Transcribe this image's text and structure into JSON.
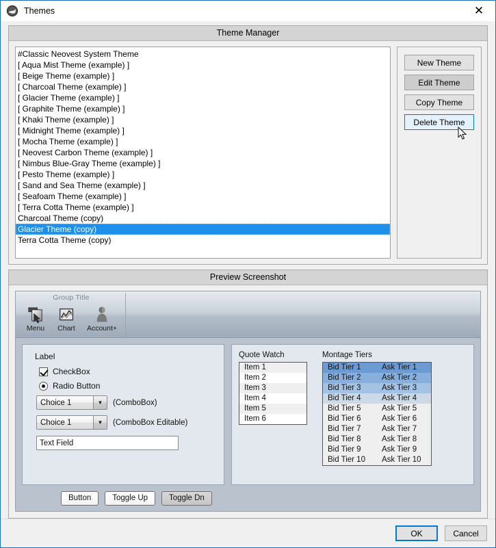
{
  "window": {
    "title": "Themes",
    "app_icon": "themes-logo-icon",
    "close_label": "✕",
    "accent_color": "#0078d7",
    "selection_color": "#1f8fec"
  },
  "theme_manager": {
    "header": "Theme Manager",
    "themes": [
      {
        "label": "#Classic Neovest System Theme",
        "selected": false
      },
      {
        "label": "[ Aqua Mist Theme (example) ]",
        "selected": false
      },
      {
        "label": "[ Beige Theme (example) ]",
        "selected": false
      },
      {
        "label": "[ Charcoal Theme (example) ]",
        "selected": false
      },
      {
        "label": "[ Glacier Theme (example) ]",
        "selected": false
      },
      {
        "label": "[ Graphite Theme (example) ]",
        "selected": false
      },
      {
        "label": "[ Khaki Theme (example) ]",
        "selected": false
      },
      {
        "label": "[ Midnight Theme (example) ]",
        "selected": false
      },
      {
        "label": "[ Mocha Theme (example) ]",
        "selected": false
      },
      {
        "label": "[ Neovest Carbon Theme (example) ]",
        "selected": false
      },
      {
        "label": "[ Nimbus Blue-Gray Theme (example) ]",
        "selected": false
      },
      {
        "label": "[ Pesto Theme (example) ]",
        "selected": false
      },
      {
        "label": "[ Sand and Sea Theme (example) ]",
        "selected": false
      },
      {
        "label": "[ Seafoam Theme (example) ]",
        "selected": false
      },
      {
        "label": "[ Terra Cotta Theme (example) ]",
        "selected": false
      },
      {
        "label": "Charcoal Theme (copy)",
        "selected": false
      },
      {
        "label": "Glacier Theme (copy)",
        "selected": true
      },
      {
        "label": "Terra Cotta Theme (copy)",
        "selected": false
      }
    ],
    "buttons": [
      {
        "label": "New Theme",
        "state": "normal"
      },
      {
        "label": "Edit Theme",
        "state": "alt"
      },
      {
        "label": "Copy Theme",
        "state": "normal"
      },
      {
        "label": "Delete Theme",
        "state": "hovered"
      }
    ]
  },
  "preview": {
    "header": "Preview Screenshot",
    "ribbon": {
      "group_title": "Group Title",
      "items": [
        {
          "label": "Menu",
          "icon": "menu-page-cursor-icon"
        },
        {
          "label": "Chart",
          "icon": "line-chart-icon"
        },
        {
          "label": "Account+",
          "icon": "account-person-icon"
        }
      ]
    },
    "form": {
      "label": "Label",
      "checkbox": {
        "label": "CheckBox",
        "checked": true
      },
      "radio": {
        "label": "Radio Button",
        "checked": true
      },
      "combo1": {
        "value": "Choice 1",
        "note": "(ComboBox)"
      },
      "combo2": {
        "value": "Choice 1",
        "note": "(ComboBox Editable)"
      },
      "textfield": {
        "value": "Text Field",
        "placeholder": "Text Field"
      }
    },
    "quote_watch": {
      "title": "Quote Watch",
      "items": [
        "Item 1",
        "Item 2",
        "Item 3",
        "Item 4",
        "Item 5",
        "Item 6"
      ]
    },
    "montage": {
      "title": "Montage Tiers",
      "rows": [
        {
          "bid": "Bid Tier 1",
          "ask": "Ask Tier 1",
          "bg": "#6b9bd2"
        },
        {
          "bid": "Bid Tier 2",
          "ask": "Ask Tier 2",
          "bg": "#87b0de"
        },
        {
          "bid": "Bid Tier 3",
          "ask": "Ask Tier 3",
          "bg": "#a4c2e4"
        },
        {
          "bid": "Bid Tier 4",
          "ask": "Ask Tier 4",
          "bg": "#ccd9e6"
        },
        {
          "bid": "Bid Tier 5",
          "ask": "Ask Tier 5",
          "bg": "#efefef"
        },
        {
          "bid": "Bid Tier 6",
          "ask": "Ask Tier 6",
          "bg": "#efefef"
        },
        {
          "bid": "Bid Tier 7",
          "ask": "Ask Tier 7",
          "bg": "#efefef"
        },
        {
          "bid": "Bid Tier 8",
          "ask": "Ask Tier 8",
          "bg": "#efefef"
        },
        {
          "bid": "Bid Tier 9",
          "ask": "Ask Tier 9",
          "bg": "#efefef"
        },
        {
          "bid": "Bid Tier 10",
          "ask": "Ask Tier 10",
          "bg": "#efefef"
        }
      ]
    },
    "buttons": [
      {
        "label": "Button",
        "state": "normal"
      },
      {
        "label": "Toggle Up",
        "state": "normal"
      },
      {
        "label": "Toggle Dn",
        "state": "pressed"
      }
    ]
  },
  "footer": {
    "ok_label": "OK",
    "cancel_label": "Cancel"
  }
}
